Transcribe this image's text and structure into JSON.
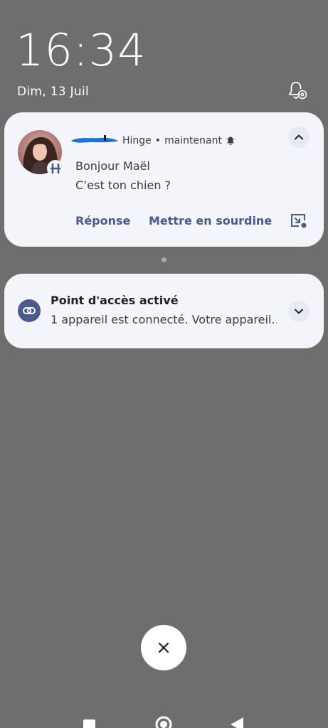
{
  "lockscreen": {
    "time": "16:34",
    "date": "Dim, 13 Juil"
  },
  "notifications": {
    "hinge": {
      "app_name": "Hinge",
      "separator": "•",
      "time_ago": "maintenant",
      "messages": [
        "Bonjour Maël",
        "C’est ton chien ?"
      ],
      "actions": {
        "reply": "Réponse",
        "mute": "Mettre en sourdine"
      },
      "badge_icon": "hinge-h-icon",
      "collapse_icon": "chevron-up-icon",
      "bubble_icon": "open-in-bubble-icon"
    },
    "hotspot": {
      "title": "Point d'accès activé",
      "text": "1 appareil est connecté. Votre appareil…",
      "icon": "hotspot-link-icon",
      "expand_icon": "chevron-down-icon"
    }
  },
  "colors": {
    "background": "#6e6e6e",
    "card": "#f4f5fa",
    "accent": "#4a5a8c",
    "redaction": "#1a73d9"
  }
}
